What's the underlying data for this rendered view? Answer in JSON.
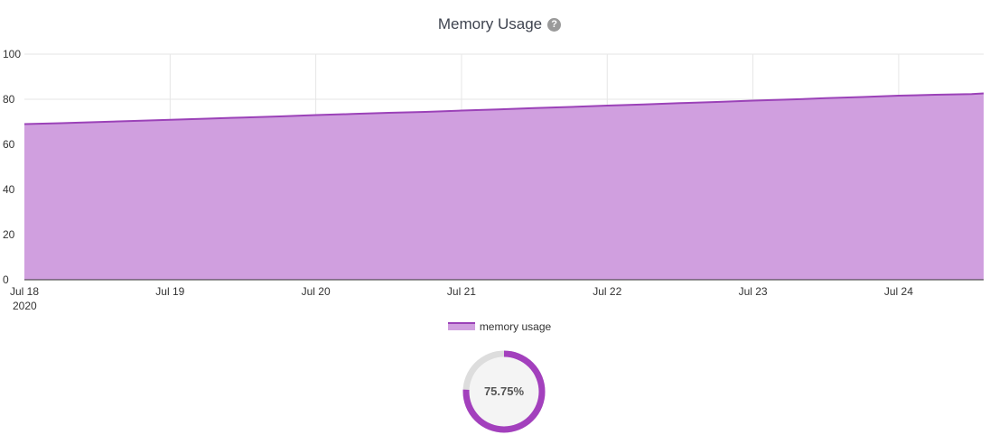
{
  "title": "Memory Usage",
  "help_icon": "question-circle-icon",
  "chart_data": {
    "type": "area",
    "title": "Memory Usage",
    "xlabel": "",
    "ylabel": "",
    "ylim": [
      0,
      100
    ],
    "y_ticks": [
      "0",
      "20",
      "40",
      "60",
      "80",
      "100"
    ],
    "x_ticks": [
      "Jul 18",
      "Jul 19",
      "Jul 20",
      "Jul 21",
      "Jul 22",
      "Jul 23",
      "Jul 24"
    ],
    "x_year_label": "2020",
    "x_range": [
      "2020-07-18",
      "2020-07-24 14:00"
    ],
    "grid": true,
    "legend": "bottom",
    "series": [
      {
        "name": "memory usage",
        "color": "#9b42b8",
        "fill": "#d09fdf",
        "x": [
          "2020-07-18 00:00",
          "2020-07-18 06:00",
          "2020-07-18 12:00",
          "2020-07-18 18:00",
          "2020-07-19 00:00",
          "2020-07-19 06:00",
          "2020-07-19 12:00",
          "2020-07-19 18:00",
          "2020-07-20 00:00",
          "2020-07-20 06:00",
          "2020-07-20 12:00",
          "2020-07-20 18:00",
          "2020-07-21 00:00",
          "2020-07-21 06:00",
          "2020-07-21 12:00",
          "2020-07-21 18:00",
          "2020-07-22 00:00",
          "2020-07-22 06:00",
          "2020-07-22 12:00",
          "2020-07-22 18:00",
          "2020-07-23 00:00",
          "2020-07-23 06:00",
          "2020-07-23 12:00",
          "2020-07-23 18:00",
          "2020-07-24 00:00",
          "2020-07-24 06:00",
          "2020-07-24 12:00",
          "2020-07-24 14:00"
        ],
        "values": [
          69.0,
          69.4,
          69.9,
          70.4,
          70.9,
          71.4,
          71.9,
          72.4,
          73.0,
          73.5,
          74.0,
          74.4,
          75.0,
          75.5,
          76.1,
          76.6,
          77.2,
          77.7,
          78.3,
          78.8,
          79.4,
          79.9,
          80.5,
          81.0,
          81.6,
          82.0,
          82.3,
          82.6
        ]
      }
    ]
  },
  "gauge": {
    "value": 75.75,
    "label": "75.75%",
    "color": "#a340bd",
    "track_color": "#dddddd",
    "center_color": "#f4f4f4"
  }
}
